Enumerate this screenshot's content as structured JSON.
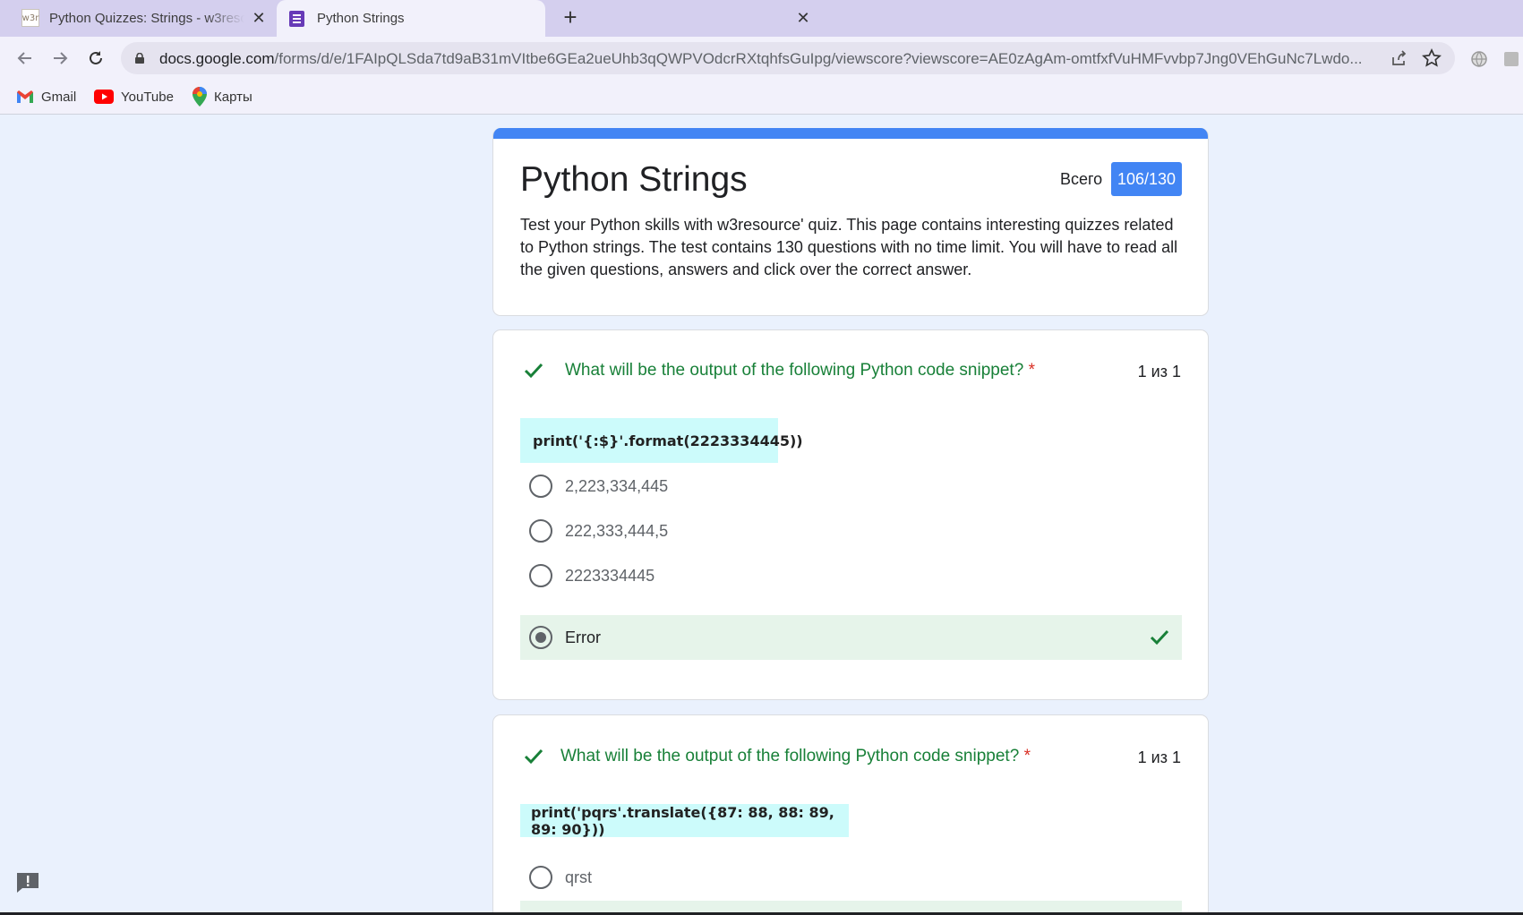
{
  "browser": {
    "tabs": [
      {
        "favicon": "w3r",
        "title": "Python Quizzes: Strings - w3resource"
      },
      {
        "title": "Python Strings"
      }
    ],
    "url_host": "docs.google.com",
    "url_path": "/forms/d/e/1FAIpQLSda7td9aB31mVItbe6GEa2ueUhb3qQWPVOdcrRXtqhfsGuIpg/viewscore?viewscore=AE0zAgAm-omtfxfVuHMFvvbp7Jng0VEhGuNc7Lwdo...",
    "bookmarks": [
      {
        "label": "Gmail",
        "icon": "gmail-icon"
      },
      {
        "label": "YouTube",
        "icon": "youtube-icon"
      },
      {
        "label": "Карты",
        "icon": "maps-icon"
      }
    ]
  },
  "form": {
    "title": "Python Strings",
    "total_label": "Всего",
    "score": "106/130",
    "description": "Test your Python skills with w3resource' quiz. This page contains interesting quizzes related to Python strings. The test contains 130 questions with no time limit. You will have to read all the given questions, answers and click over the correct answer."
  },
  "questions": [
    {
      "text": "What will be the output of the following Python code snippet?",
      "required_mark": "*",
      "points": "1 из 1",
      "code": "print('{:$}'.format(2223334445))",
      "options": [
        {
          "label": "2,223,334,445",
          "selected": false,
          "correct": false
        },
        {
          "label": "222,333,444,5",
          "selected": false,
          "correct": false
        },
        {
          "label": "2223334445",
          "selected": false,
          "correct": false
        },
        {
          "label": "Error",
          "selected": true,
          "correct": true
        }
      ]
    },
    {
      "text": "What will be the output of the following Python code snippet?",
      "required_mark": "*",
      "points": "1 из 1",
      "code": "print('pqrs'.translate({87: 88, 88: 89, 89: 90}))",
      "options": [
        {
          "label": "qrst",
          "selected": false,
          "correct": false
        }
      ]
    }
  ],
  "colors": {
    "accent": "#4285f4",
    "correct_green": "#188038",
    "correct_bg": "#e6f4ea",
    "code_bg": "#ccfbfb",
    "page_bg": "#eaf1fd"
  }
}
